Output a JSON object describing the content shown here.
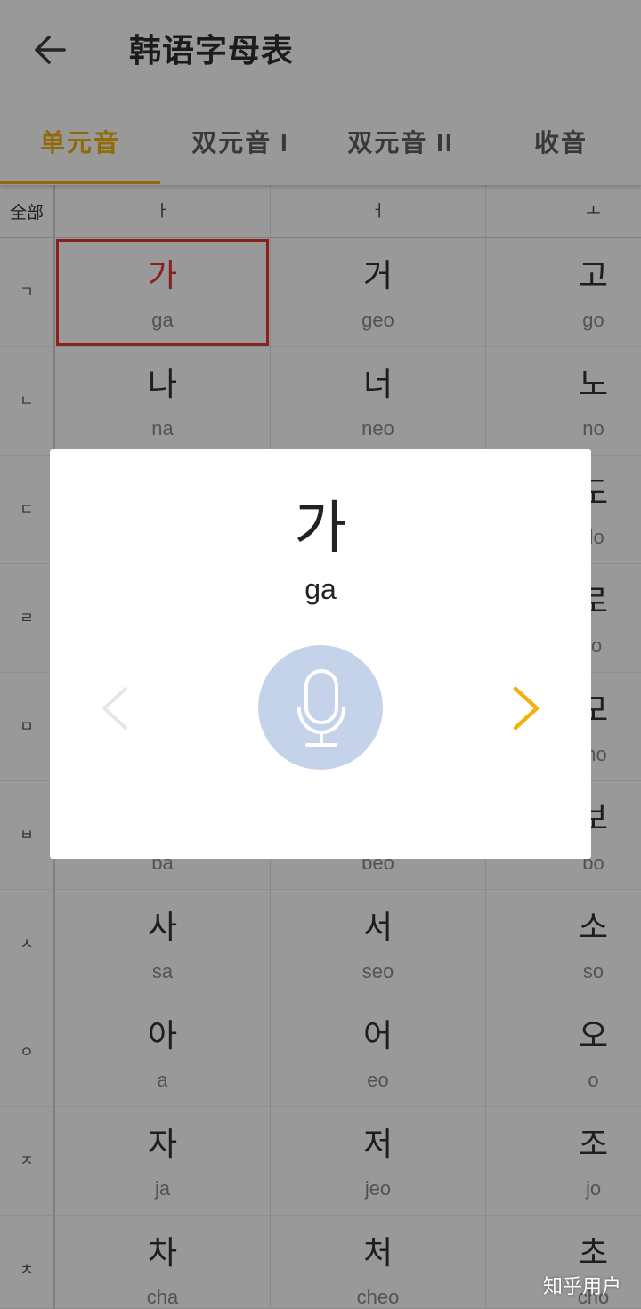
{
  "app_bar": {
    "back_icon": "arrow-left-icon",
    "title": "韩语字母表"
  },
  "tabs": [
    {
      "label": "单元音",
      "selected": true
    },
    {
      "label": "双元音 I",
      "selected": false
    },
    {
      "label": "双元音 II",
      "selected": false
    },
    {
      "label": "收音",
      "selected": false
    }
  ],
  "table": {
    "corner_label": "全部",
    "columns": [
      "ㅏ",
      "ㅓ",
      "ㅗ"
    ],
    "rows": [
      {
        "label": "ㄱ",
        "cells": [
          {
            "char": "가",
            "roman": "ga",
            "selected": true
          },
          {
            "char": "거",
            "roman": "geo"
          },
          {
            "char": "고",
            "roman": "go"
          }
        ]
      },
      {
        "label": "ㄴ",
        "cells": [
          {
            "char": "나",
            "roman": "na"
          },
          {
            "char": "너",
            "roman": "neo"
          },
          {
            "char": "노",
            "roman": "no"
          }
        ]
      },
      {
        "label": "ㄷ",
        "cells": [
          {},
          {},
          {
            "char": "도",
            "roman": "do"
          }
        ]
      },
      {
        "label": "ㄹ",
        "cells": [
          {},
          {},
          {
            "char": "로",
            "roman": "ro"
          }
        ]
      },
      {
        "label": "ㅁ",
        "cells": [
          {},
          {},
          {
            "char": "모",
            "roman": "mo"
          }
        ]
      },
      {
        "label": "ㅂ",
        "cells": [
          {
            "roman": "ba"
          },
          {
            "roman": "beo"
          },
          {
            "char": "보",
            "roman": "bo"
          }
        ]
      },
      {
        "label": "ㅅ",
        "cells": [
          {
            "char": "사",
            "roman": "sa"
          },
          {
            "char": "서",
            "roman": "seo"
          },
          {
            "char": "소",
            "roman": "so"
          }
        ]
      },
      {
        "label": "ㅇ",
        "cells": [
          {
            "char": "아",
            "roman": "a"
          },
          {
            "char": "어",
            "roman": "eo"
          },
          {
            "char": "오",
            "roman": "o"
          }
        ]
      },
      {
        "label": "ㅈ",
        "cells": [
          {
            "char": "자",
            "roman": "ja"
          },
          {
            "char": "저",
            "roman": "jeo"
          },
          {
            "char": "조",
            "roman": "jo"
          }
        ]
      },
      {
        "label": "ㅊ",
        "cells": [
          {
            "char": "차",
            "roman": "cha"
          },
          {
            "char": "처",
            "roman": "cheo"
          },
          {
            "char": "초",
            "roman": "cho"
          }
        ]
      }
    ]
  },
  "dialog": {
    "char": "가",
    "roman": "ga",
    "prev_icon": "chevron-left-icon",
    "mic_icon": "microphone-icon",
    "next_icon": "chevron-right-icon",
    "prev_enabled": false,
    "next_enabled": true
  },
  "watermark": "知乎用户",
  "colors": {
    "accent": "#F4B10D",
    "selected_cell": "#E53935",
    "mic_button": "#C5D3EA"
  }
}
